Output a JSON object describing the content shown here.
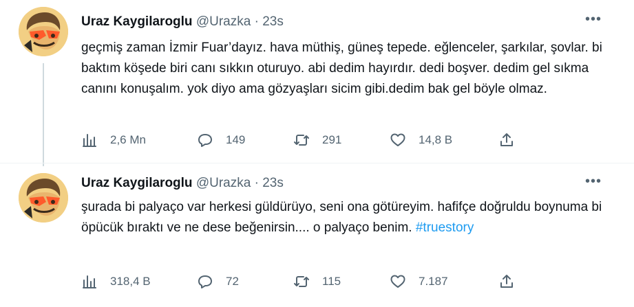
{
  "tweets": [
    {
      "author": {
        "name": "Uraz Kaygilaroglu",
        "handle": "@Urazka"
      },
      "separator": "·",
      "time": "23s",
      "more_icon": "more-horizontal-icon",
      "text": "geçmiş zaman İzmir Fuar’dayız. hava müthiş, güneş tepede. eğlenceler, şarkılar, şovlar. bi baktım köşede biri canı sıkkın oturuyo. abi dedim hayırdır. dedi boşver. dedim gel sıkma canını konuşalım. yok diyo ama gözyaşları sicim gibi.dedim bak gel böyle olmaz.",
      "hashtag": "",
      "stats": {
        "views": "2,6 Mn",
        "replies": "149",
        "retweets": "291",
        "likes": "14,8 B"
      }
    },
    {
      "author": {
        "name": "Uraz Kaygilaroglu",
        "handle": "@Urazka"
      },
      "separator": "·",
      "time": "23s",
      "more_icon": "more-horizontal-icon",
      "text": "şurada bi palyaço var herkesi güldürüyo, seni ona götüreyim. hafifçe doğruldu boynuma bi öpücük bıraktı ve ne dese beğenirsin.... o palyaço benim. ",
      "hashtag": "#truestory",
      "stats": {
        "views": "318,4 B",
        "replies": "72",
        "retweets": "115",
        "likes": "7.187"
      }
    }
  ],
  "colors": {
    "text": "#0f1419",
    "secondary": "#536471",
    "link": "#1d9bf0",
    "thread_line": "#cfd9de",
    "divider": "#eff3f4"
  },
  "icons": [
    "views-icon",
    "reply-icon",
    "retweet-icon",
    "like-icon",
    "share-icon",
    "more-horizontal-icon"
  ]
}
